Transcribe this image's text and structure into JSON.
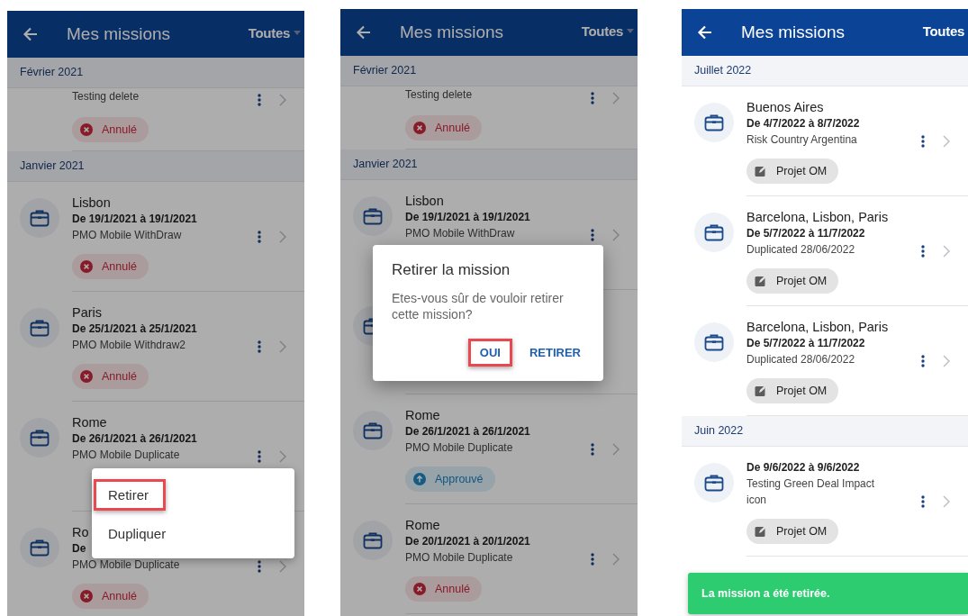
{
  "screens": [
    {
      "header": {
        "title": "Mes missions",
        "filter": "Toutes",
        "caret": true
      },
      "dimmed": true,
      "sections": [
        {
          "month": "Février 2021",
          "items": [
            {
              "partial": true,
              "subtitle": "Testing delete",
              "menu": true,
              "status": {
                "kind": "cancelled",
                "label": "Annulé"
              }
            }
          ]
        },
        {
          "month": "Janvier 2021",
          "items": [
            {
              "partial": false,
              "title": "Lisbon",
              "dates": "De 19/1/2021 à 19/1/2021",
              "subtitle": "PMO Mobile WithDraw",
              "menu": true,
              "status": {
                "kind": "cancelled",
                "label": "Annulé"
              }
            },
            {
              "partial": false,
              "title": "Paris",
              "dates": "De 25/1/2021 à 25/1/2021",
              "subtitle": "PMO Mobile Withdraw2",
              "menu": true,
              "status": {
                "kind": "cancelled",
                "label": "Annulé"
              }
            },
            {
              "partial": false,
              "title": "Rome",
              "dates": "De 26/1/2021 à 26/1/2021",
              "subtitle": "PMO Mobile Duplicate",
              "menu": true
            },
            {
              "partial": false,
              "title": "Ro",
              "dates": "De",
              "subtitle": "PMO Mobile Duplicate",
              "menu": true,
              "status": {
                "kind": "cancelled",
                "label": "Annulé"
              }
            }
          ]
        }
      ],
      "overlay": {
        "kind": "menu",
        "items": [
          {
            "label": "Retirer",
            "highlighted": true
          },
          {
            "label": "Dupliquer",
            "highlighted": false
          }
        ]
      }
    },
    {
      "header": {
        "title": "Mes missions",
        "filter": "Toutes",
        "caret": true
      },
      "dimmed": true,
      "sections": [
        {
          "month": "Février 2021",
          "items": [
            {
              "partial": true,
              "subtitle": "Testing delete",
              "menu": true,
              "status": {
                "kind": "cancelled",
                "label": "Annulé"
              }
            }
          ]
        },
        {
          "month": "Janvier 2021",
          "items": [
            {
              "partial": false,
              "title": "Lisbon",
              "dates": "De 19/1/2021 à 19/1/2021",
              "subtitle": "PMO Mobile WithDraw",
              "menu": true
            },
            {
              "partial": false,
              "menu": false
            },
            {
              "partial": false,
              "title": "Rome",
              "dates": "De 26/1/2021 à 26/1/2021",
              "subtitle": "PMO Mobile Duplicate",
              "menu": true,
              "status": {
                "kind": "approved",
                "label": "Approuvé"
              }
            },
            {
              "partial": false,
              "title": "Rome",
              "dates": "De 20/1/2021 à 20/1/2021",
              "subtitle": "PMO Mobile Duplicate",
              "menu": true,
              "status": {
                "kind": "cancelled",
                "label": "Annulé"
              }
            }
          ]
        }
      ],
      "overlay": {
        "kind": "dialog",
        "title": "Retirer la mission",
        "message": "Etes-vous sûr de vouloir retirer cette mission?",
        "buttons": [
          {
            "label": "OUI",
            "highlighted": true
          },
          {
            "label": "RETIRER",
            "highlighted": false
          }
        ]
      }
    },
    {
      "header": {
        "title": "Mes missions",
        "filter": "Toutes",
        "caret": false
      },
      "dimmed": false,
      "sections": [
        {
          "month": "Juillet 2022",
          "items": [
            {
              "partial": false,
              "title": "Buenos Aires",
              "dates": "De 4/7/2022 à 8/7/2022",
              "subtitle": "Risk Country Argentina",
              "menu": true,
              "status": {
                "kind": "draft",
                "label": "Projet OM"
              }
            },
            {
              "partial": false,
              "title": "Barcelona, Lisbon, Paris",
              "dates": "De 5/7/2022 à 11/7/2022",
              "subtitle": "Duplicated 28/06/2022",
              "menu": true,
              "status": {
                "kind": "draft",
                "label": "Projet OM"
              }
            },
            {
              "partial": false,
              "title": "Barcelona, Lisbon, Paris",
              "dates": "De 5/7/2022 à 11/7/2022",
              "subtitle": "Duplicated 28/06/2022",
              "menu": true,
              "status": {
                "kind": "draft",
                "label": "Projet OM"
              }
            }
          ]
        },
        {
          "month": "Juin 2022",
          "items": [
            {
              "partial": false,
              "dates": "De 9/6/2022 à 9/6/2022",
              "subtitle": "Testing Green Deal Impact icon",
              "menu": true,
              "status": {
                "kind": "draft",
                "label": "Projet OM"
              }
            }
          ]
        }
      ],
      "overlay": {
        "kind": "toast",
        "message": "La mission a été retirée."
      }
    }
  ]
}
